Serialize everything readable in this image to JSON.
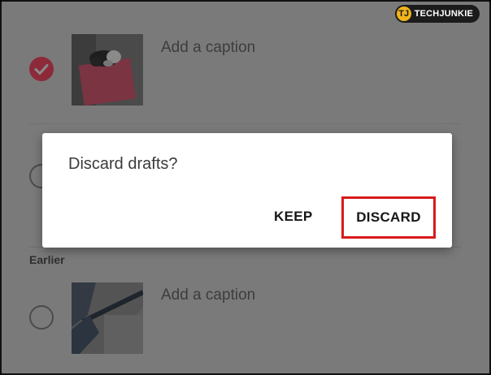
{
  "drafts": [
    {
      "caption_placeholder": "Add a caption",
      "selected": true,
      "thumbnail": "photo of a black-and-white dog lying on a pink blanket"
    },
    {
      "caption_placeholder": "Add a caption",
      "selected": false,
      "thumbnail": "photo of a mop or broom handle on a grey floor"
    }
  ],
  "section_label": "Earlier",
  "dialog": {
    "title": "Discard drafts?",
    "keep_label": "KEEP",
    "discard_label": "DISCARD"
  },
  "watermark": {
    "brand": "TECHJUNKIE"
  },
  "colors": {
    "highlight": "#d81b1b",
    "selected_check": "#e0405e"
  }
}
